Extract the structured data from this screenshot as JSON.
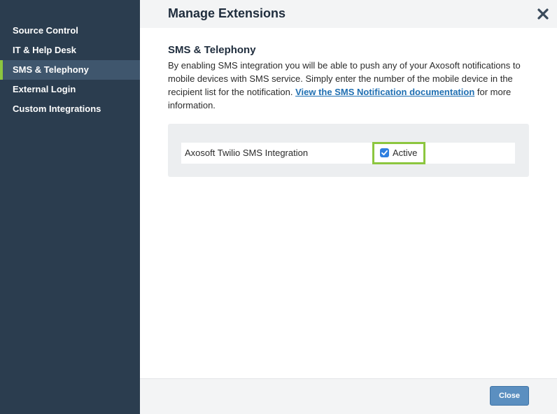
{
  "sidebar": {
    "items": [
      {
        "label": "Source Control",
        "active": false
      },
      {
        "label": "IT & Help Desk",
        "active": false
      },
      {
        "label": "SMS & Telephony",
        "active": true
      },
      {
        "label": "External Login",
        "active": false
      },
      {
        "label": "Custom Integrations",
        "active": false
      }
    ]
  },
  "header": {
    "title": "Manage Extensions",
    "close_icon": "close-x-icon"
  },
  "section": {
    "title": "SMS & Telephony",
    "description_before": "By enabling SMS integration you will be able to push any of your Axosoft notifications to mobile devices with SMS service. Simply enter the number of the mobile device in the recipient list for the notification. ",
    "link_text": "View the SMS Notification documentation",
    "description_after": " for more information."
  },
  "integration": {
    "name": "Axosoft Twilio SMS Integration",
    "active_label": "Active",
    "active_checked": true
  },
  "footer": {
    "close_label": "Close"
  },
  "colors": {
    "sidebar_bg": "#2b3d4f",
    "sidebar_active_bg": "#3f566d",
    "accent_green": "#8cc63f",
    "link_blue": "#1f6fb2",
    "button_blue": "#5b8fc0"
  }
}
